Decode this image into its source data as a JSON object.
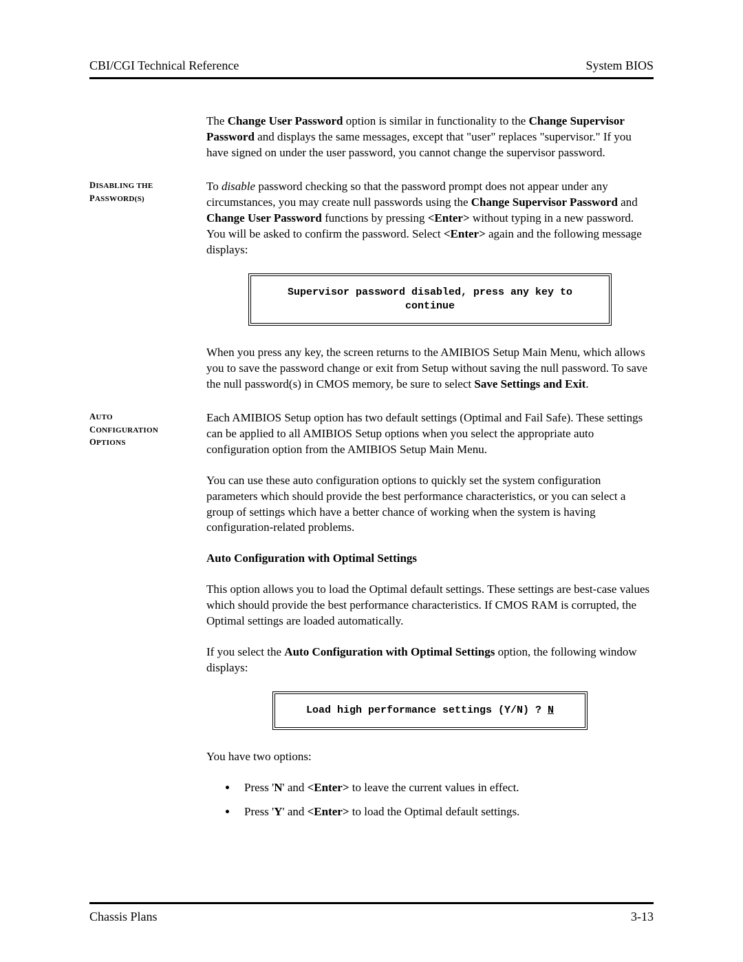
{
  "header": {
    "left": "CBI/CGI Technical Reference",
    "right": "System BIOS"
  },
  "intro": {
    "p1_a": "The ",
    "p1_b": "Change User Password",
    "p1_c": " option is similar in functionality to the ",
    "p1_d": "Change Supervisor Password",
    "p1_e": " and displays the same messages, except that \"user\" replaces \"supervisor.\"  If you have signed on under the user password, you cannot change the supervisor password."
  },
  "section1": {
    "label": "Disabling the Password(s)",
    "p1_a": "To ",
    "p1_b": "disable",
    "p1_c": " password checking so that the password prompt does not appear under any circumstances, you may create null passwords using the ",
    "p1_d": "Change Supervisor Password",
    "p1_e": " and ",
    "p1_f": "Change User Password",
    "p1_g": " functions by pressing ",
    "p1_h": "<Enter>",
    "p1_i": " without typing in a new password.  You will be asked to confirm the password.  Select ",
    "p1_j": "<Enter>",
    "p1_k": " again and the following message displays:",
    "box": "Supervisor password disabled, press any key to continue",
    "p2_a": "When you press any key, the screen returns to the AMIBIOS Setup Main Menu, which allows you to save the password change or exit from Setup without saving the null password.  To save the null password(s) in CMOS memory, be sure to select ",
    "p2_b": "Save Settings and Exit",
    "p2_c": "."
  },
  "section2": {
    "label": "Auto Configuration Options",
    "p1": "Each AMIBIOS Setup option has two default settings (Optimal and Fail Safe).  These settings can be applied to all AMIBIOS Setup options when you select the appropriate auto configuration option from the AMIBIOS Setup Main Menu.",
    "p2": "You can use these auto configuration options to quickly set the system configuration parameters which should provide the best performance characteristics, or you can select a group of settings which have a better chance of working when the system is having configuration-related problems.",
    "subhead": "Auto Configuration with Optimal Settings",
    "p3": "This option allows you to load the Optimal default settings.  These settings are best-case values which should provide the best performance characteristics.  If CMOS RAM is corrupted, the Optimal settings are loaded automatically.",
    "p4_a": "If you select the ",
    "p4_b": "Auto Configuration with Optimal Settings",
    "p4_c": " option, the following window displays:",
    "box_a": "Load high performance settings (Y/N) ? ",
    "box_b": "N",
    "p5": "You have two options:",
    "li1_a": "Press '",
    "li1_b": "N",
    "li1_c": "' and ",
    "li1_d": "<Enter>",
    "li1_e": " to leave the current values in effect.",
    "li2_a": "Press '",
    "li2_b": "Y",
    "li2_c": "' and ",
    "li2_d": "<Enter>",
    "li2_e": " to load the Optimal default settings."
  },
  "footer": {
    "left": "Chassis Plans",
    "right": "3-13"
  }
}
